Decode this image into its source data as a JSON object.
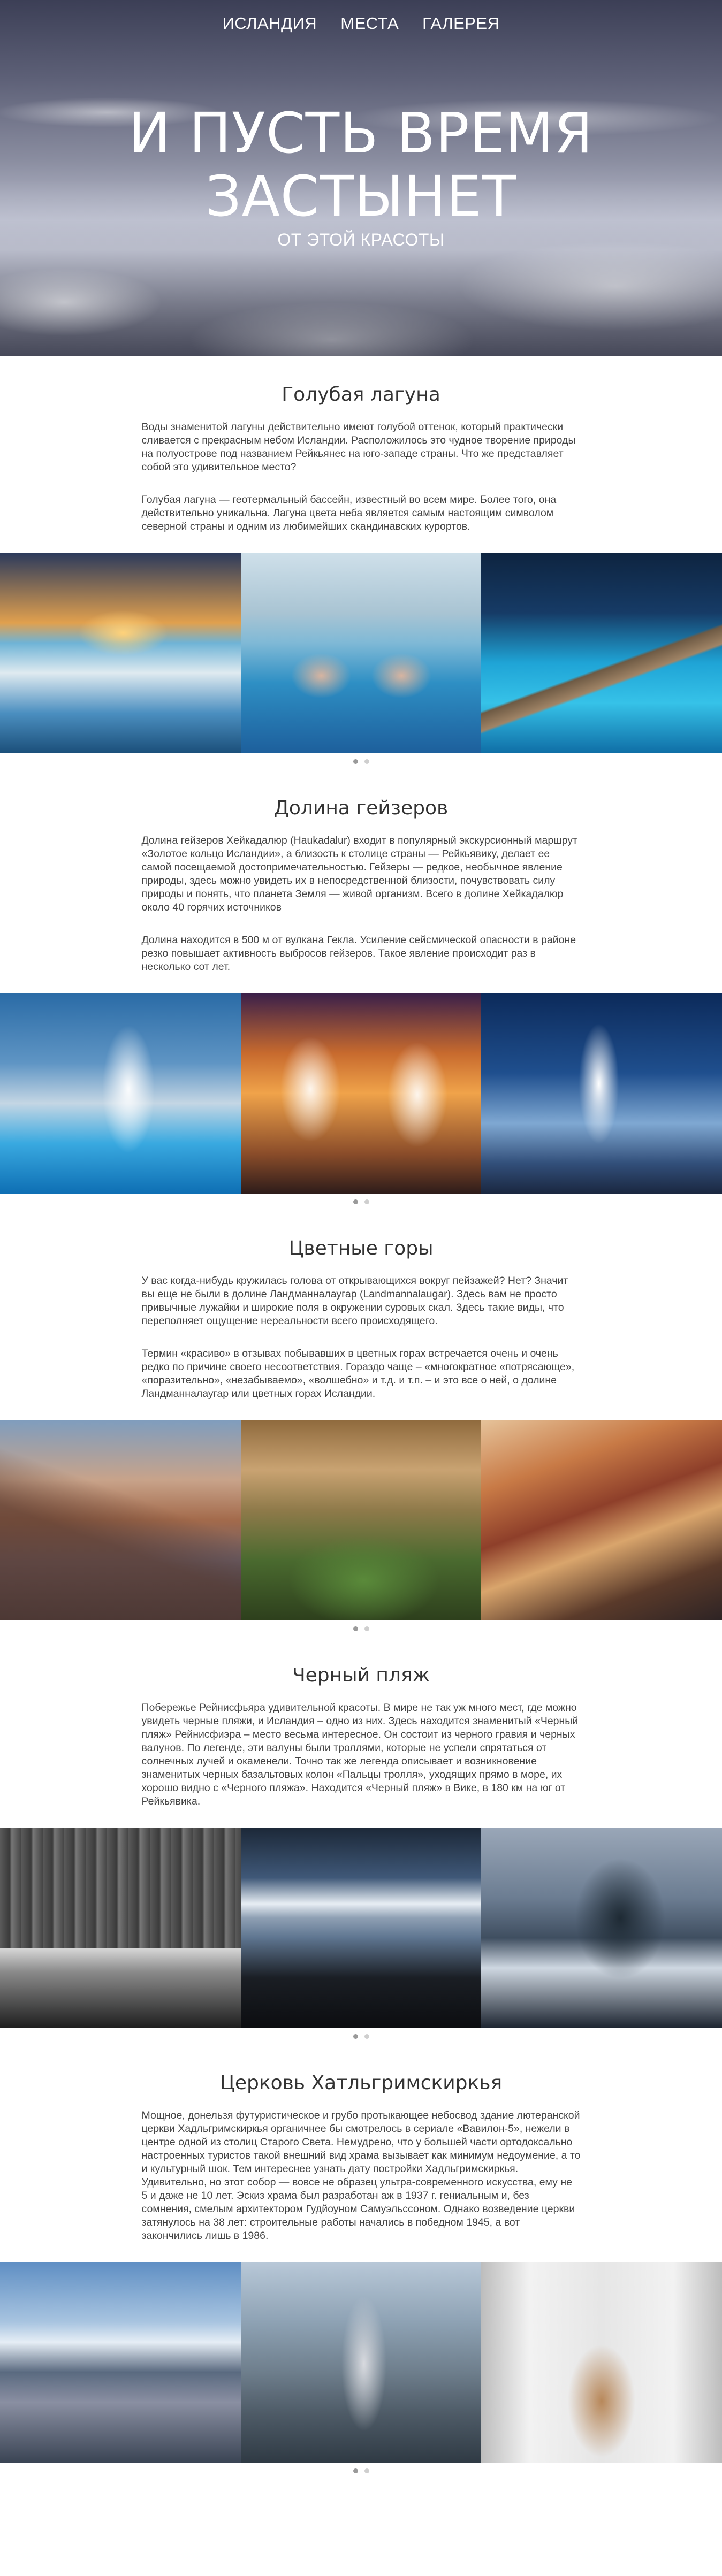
{
  "nav": {
    "items": [
      "ИСЛАНДИЯ",
      "МЕСТА",
      "ГАЛЕРЕЯ"
    ]
  },
  "hero": {
    "title_line1": "И ПУСТЬ ВРЕМЯ",
    "title_line2": "ЗАСТЫНЕТ",
    "subtitle": "ОТ ЭТОЙ КРАСОТЫ"
  },
  "sections": [
    {
      "title": "Голубая лагуна",
      "paragraphs": [
        "Воды знаменитой лагуны действительно имеют голубой оттенок, который практически сливается с прекрасным небом Исландии. Расположилось это чудное творение природы на полуострове под названием Рейкьянес на юго-западе страны. Что же представляет собой это удивительное место?",
        "Голубая лагуна — геотермальный бассейн, известный во всем мире. Более того, она действительно уникальна. Лагуна цвета неба является самым настоящим символом северной страны и одним из любимейших скандинавских курортов."
      ]
    },
    {
      "title": "Долина гейзеров",
      "paragraphs": [
        "Долина гейзеров Хейкадалюр (Haukadalur) входит в популярный экскурсионный маршрут «Золотое кольцо Исландии», а близость к столице страны — Рейкьявику, делает ее самой посещаемой достопримечательностью. Гейзеры — редкое, необычное явление природы, здесь можно увидеть их в непосредственной близости, почувствовать силу природы и понять, что планета Земля — живой организм. Всего в долине Хейкадалюр около 40 горячих источников",
        "Долина находится в 500 м от вулкана Гекла. Усиление сейсмической опасности в районе резко повышает активность выбросов гейзеров. Такое явление происходит раз в несколько сот лет."
      ]
    },
    {
      "title": "Цветные горы",
      "paragraphs": [
        "У вас когда-нибудь кружилась голова от открывающихся вокруг пейзажей? Нет? Значит вы еще не были в долине Ландманналаугар (Landmannalaugar). Здесь вам не просто привычные лужайки и широкие поля в окружении суровых скал. Здесь такие виды, что переполняет ощущение нереальности всего происходящего.",
        "Термин «красиво» в отзывах побывавших в цветных горах встречается очень и очень редко по причине своего несоответствия. Гораздо чаще – «многократное «потрясающе», «поразительно», «незабываемо», «волшебно» и т.д. и т.п. – и это все о ней, о долине Ландманналаугар или цветных горах Исландии."
      ]
    },
    {
      "title": "Черный пляж",
      "paragraphs": [
        "Побережье Рейнисфьяра удивительной красоты. В мире не так уж много мест, где можно увидеть черные пляжи, и Исландия – одно из них. Здесь находится знаменитый «Черный пляж» Рейнисфиэра – место весьма интересное. Он состоит из черного гравия и черных валунов. По легенде, эти валуны были троллями, которые не успели спрятаться от солнечных лучей и окаменели. Точно так же легенда описывает и возникновение знаменитых черных базальтовых колон «Пальцы тролля», уходящих прямо в море, их хорошо видно с «Черного пляжа». Находится «Черный пляж» в Вике, в 180 км на юг от Рейкьявика."
      ]
    },
    {
      "title": "Церковь Хатльгримскиркья",
      "paragraphs": [
        "Мощное, донельзя футуристическое и грубо протыкающее небосвод здание лютеранской церкви Хадльгримскиркья органичнее бы смотрелось в сериале «Вавилон-5», нежели в центре одной из столиц Старого Света. Немудрено, что у большей части ортодоксально настроенных туристов такой внешний вид храма вызывает как минимум недоумение, а то и культурный шок. Тем интереснее узнать дату постройки Хадльгримскиркья. Удивительно, но этот собор — вовсе не образец ультра-современного искусства, ему не 5 и даже не 10 лет. Эскиз храма был разработан аж в 1937 г. гениальным и, без сомнения, смелым архитектором Гудйоуном Самуэльссоном. Однако возведение церкви затянулось на 38 лет: строительные работы начались в победном 1945, а вот закончились лишь в 1986."
      ]
    }
  ]
}
